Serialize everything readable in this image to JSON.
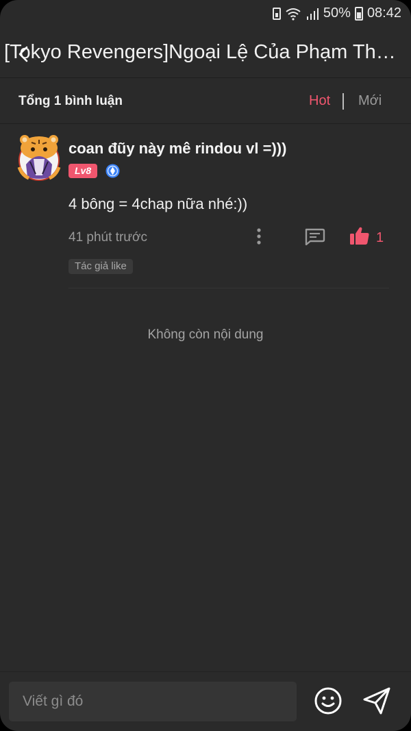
{
  "status_bar": {
    "battery_percent": "50%",
    "time": "08:42",
    "icons": [
      "recycle-battery-icon",
      "wifi-icon",
      "signal-icon",
      "battery-icon"
    ]
  },
  "header": {
    "back_icon": "chevron-left-icon",
    "title": "[Tokyo Revengers]Ngoại Lệ Của Phạm Thiên"
  },
  "summary": {
    "total_label": "Tổng 1 bình luận",
    "sort_options": [
      "Hot",
      "Mới"
    ],
    "active_sort": "Hot"
  },
  "comments": [
    {
      "username": "coan đũy này mê rindou vl =)))",
      "level": "Lv8",
      "text": "4 bông = 4chap nữa nhé:))",
      "time": "41 phút trước",
      "like_count": "1",
      "author_liked_label": "Tác giả like"
    }
  ],
  "empty_message": "Không còn nội dung",
  "composer": {
    "placeholder": "Viết gì đó"
  },
  "colors": {
    "accent": "#f0566e",
    "background": "#2a2a2a",
    "verify_blue": "#3b82f6"
  }
}
